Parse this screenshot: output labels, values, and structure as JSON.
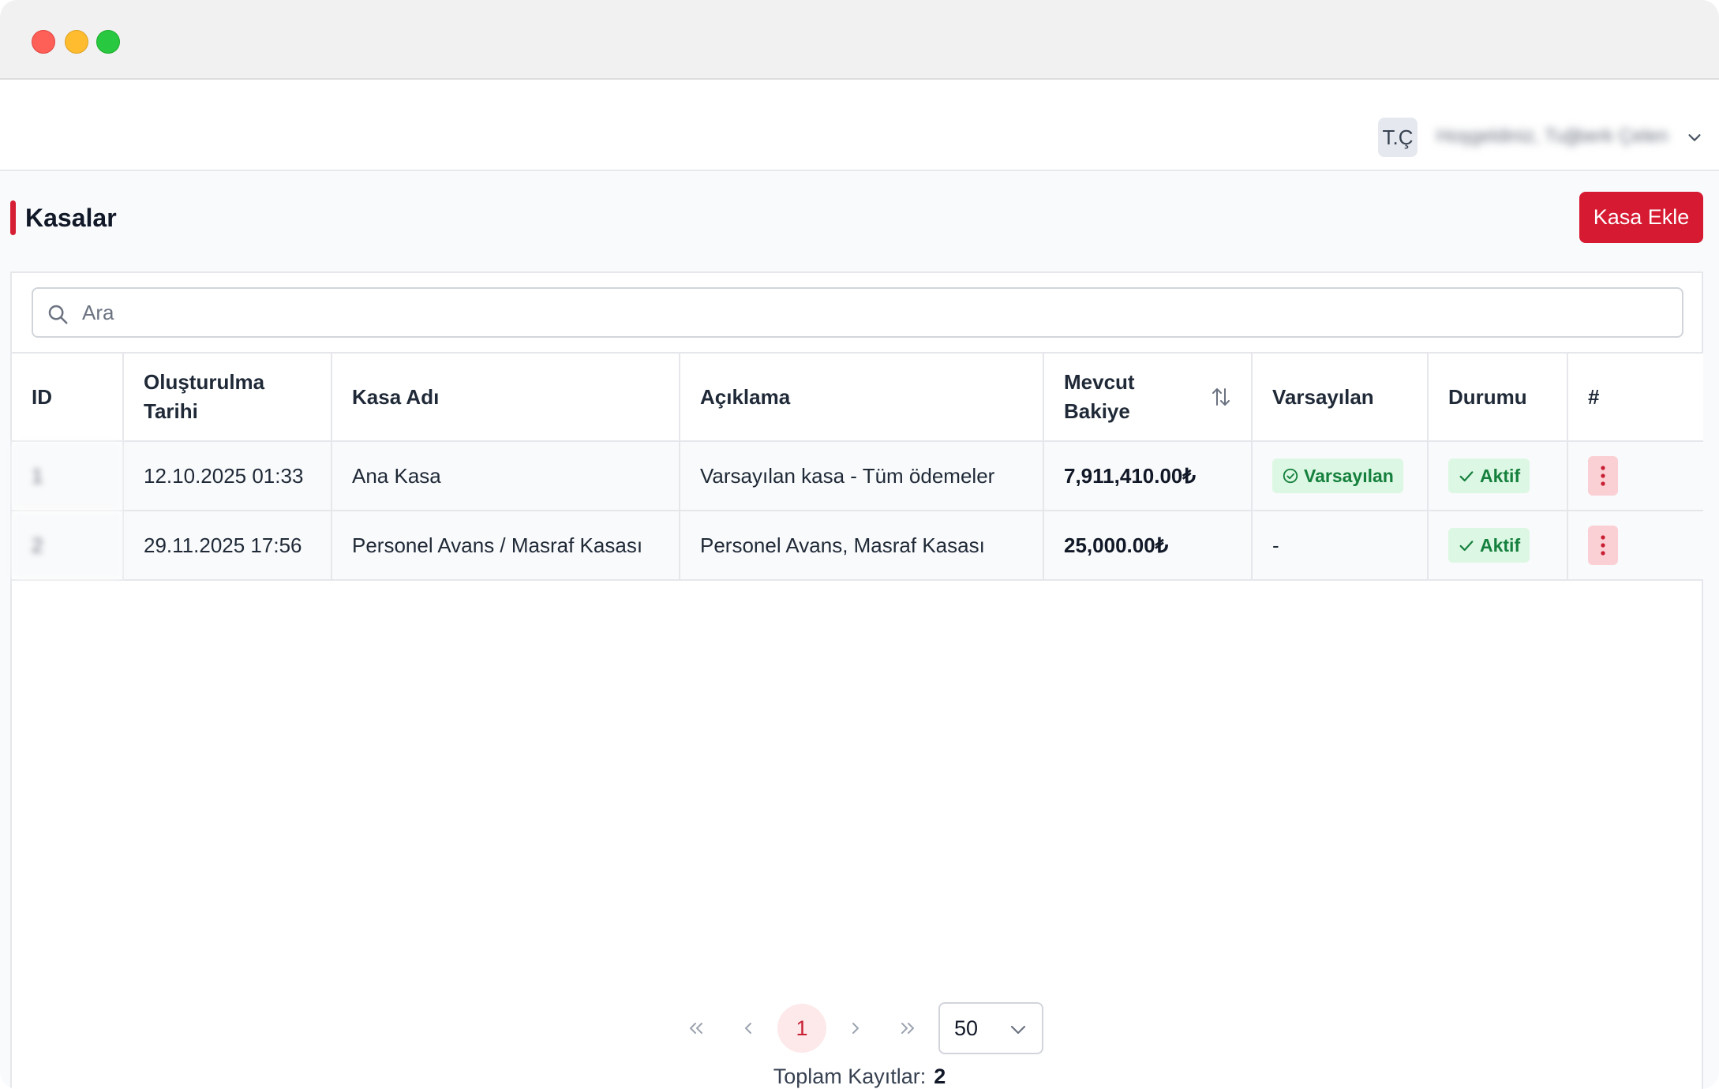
{
  "window": {
    "controls": [
      "close",
      "minimize",
      "maximize"
    ]
  },
  "header": {
    "avatar_initials": "T.Ç",
    "welcome_text": "Hoşgeldiniz, Tuğberk Çelen",
    "user_menu_icon": "chevron-down-icon"
  },
  "page": {
    "title": "Kasalar",
    "add_button_label": "Kasa Ekle",
    "accent_color": "#d51a31"
  },
  "search": {
    "placeholder": "Ara",
    "value": "",
    "icon": "search-icon"
  },
  "table": {
    "headers": {
      "id": "ID",
      "created": "Oluşturulma Tarihi",
      "name": "Kasa Adı",
      "description": "Açıklama",
      "balance": "Mevcut Bakiye",
      "default": "Varsayılan",
      "status": "Durumu",
      "actions": "#"
    },
    "rows": [
      {
        "id": "1",
        "created": "12.10.2025 01:33",
        "name": "Ana Kasa",
        "description": "Varsayılan kasa - Tüm ödemeler",
        "balance": "7,911,410.00₺",
        "default": "Varsayılan",
        "status": "Aktif"
      },
      {
        "id": "2",
        "created": "29.11.2025 17:56",
        "name": "Personel Avans / Masraf Kasası",
        "description": "Personel Avans, Masraf Kasası",
        "balance": "25,000.00₺",
        "default": "-",
        "status": "Aktif"
      }
    ]
  },
  "pagination": {
    "current_page": "1",
    "page_size": "50",
    "total_label": "Toplam Kayıtlar:",
    "total_value": "2"
  }
}
